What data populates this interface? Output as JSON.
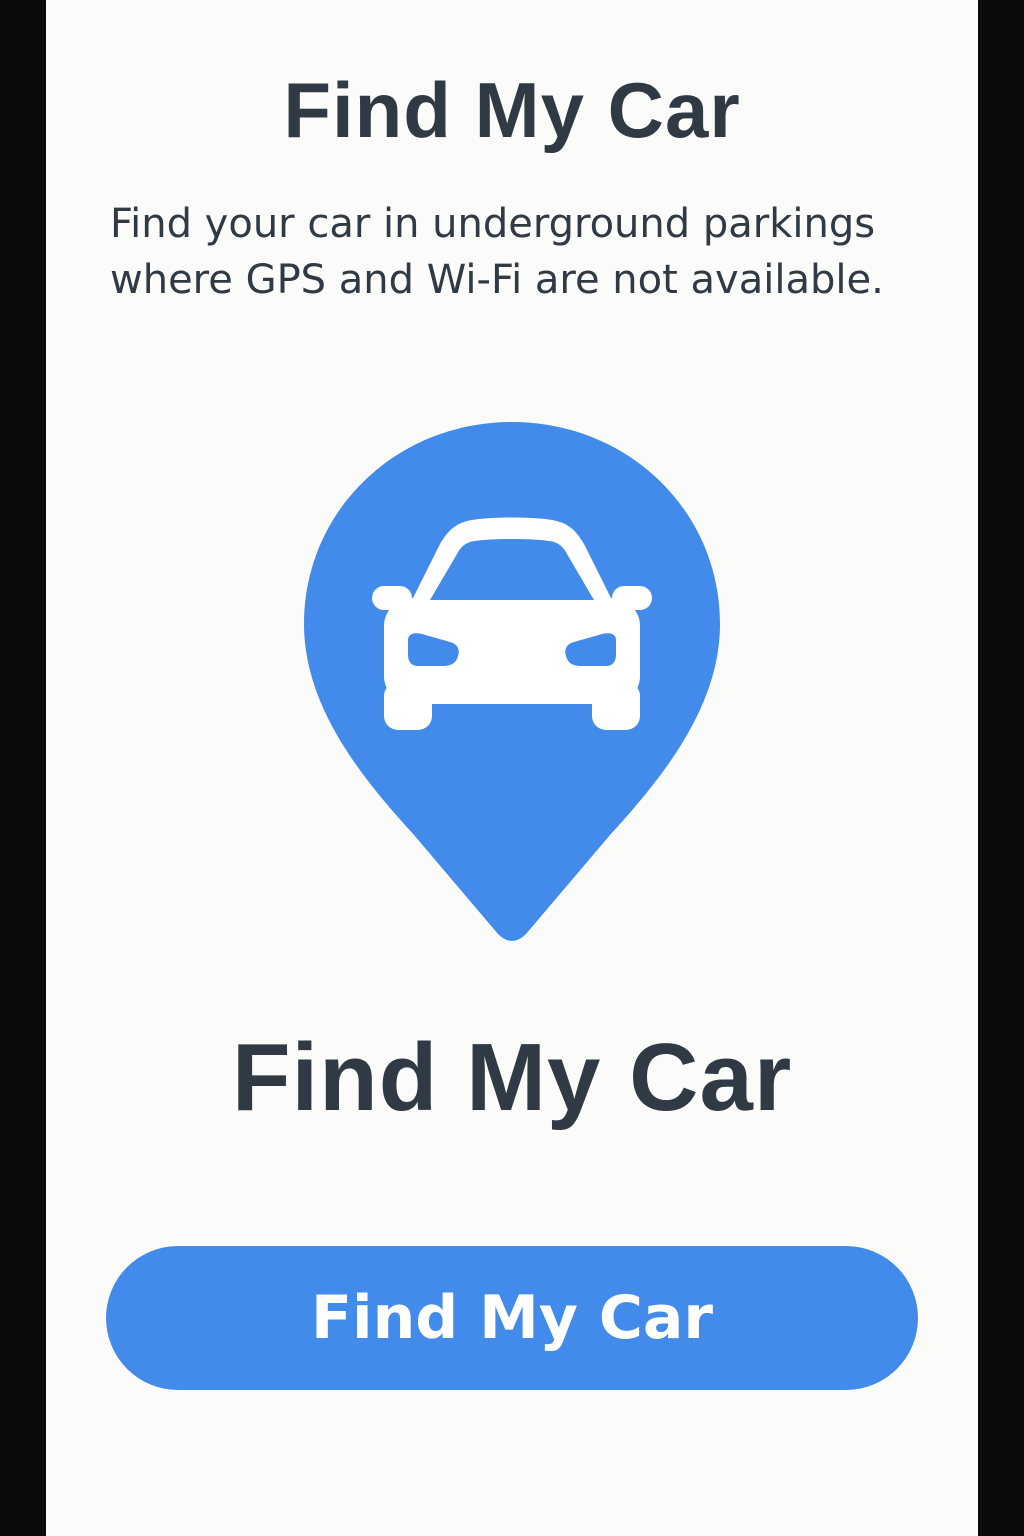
{
  "header": {
    "title": "Find My Car",
    "subtitle_lines": [
      "Find your car in underground parkings",
      "where GPS and Wi-Fi are not available."
    ]
  },
  "hero": {
    "icon": "car-location-pin-icon",
    "app_name": "Find My Car"
  },
  "actions": {
    "primary_label": "Find My Car"
  },
  "colors": {
    "accent": "#428bea",
    "text": "#2f3a44",
    "background": "#fbfbf9",
    "frame": "#0b0b0b"
  }
}
